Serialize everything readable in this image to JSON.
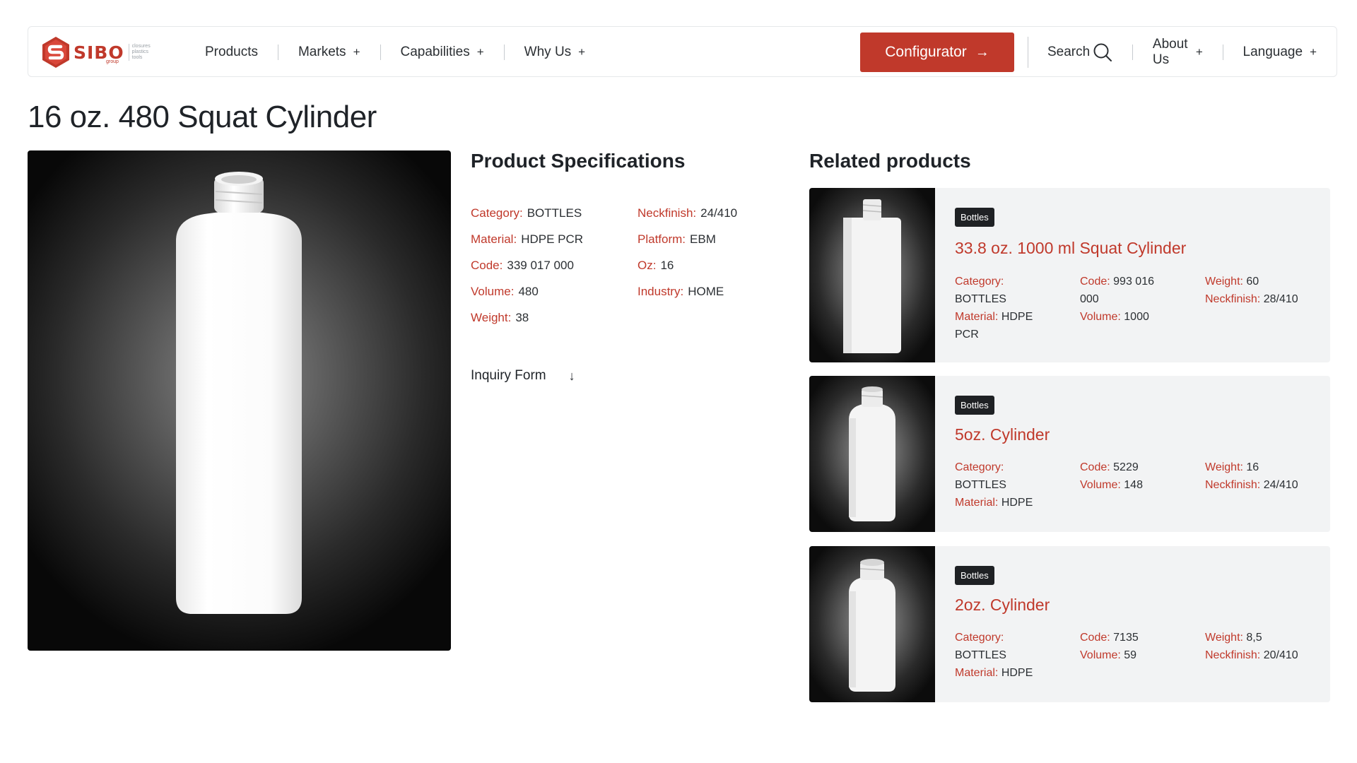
{
  "brand": {
    "logo_text": "SIBO",
    "logo_sub": [
      "closures",
      "plastics",
      "tools"
    ],
    "logo_group": "group"
  },
  "nav": {
    "products": "Products",
    "markets": "Markets",
    "capabilities": "Capabilities",
    "why_us": "Why Us",
    "plus": "+",
    "configurator": "Configurator",
    "configurator_arrow": "→",
    "search": "Search",
    "about_us": "About Us",
    "language": "Language"
  },
  "product": {
    "title": "16 oz. 480 Squat Cylinder",
    "specs_title": "Product Specifications",
    "specs": [
      {
        "label": "Category:",
        "value": "BOTTLES"
      },
      {
        "label": "Material:",
        "value": "HDPE PCR"
      },
      {
        "label": "Code:",
        "value": "339 017 000"
      },
      {
        "label": "Volume:",
        "value": "480"
      },
      {
        "label": "Weight:",
        "value": "38"
      },
      {
        "label": "Neckfinish:",
        "value": "24/410"
      },
      {
        "label": "Platform:",
        "value": "EBM"
      },
      {
        "label": "Oz:",
        "value": "16"
      },
      {
        "label": "Industry:",
        "value": "HOME"
      }
    ],
    "inquiry_label": "Inquiry Form",
    "inquiry_arrow": "↓"
  },
  "related": {
    "title": "Related products",
    "items": [
      {
        "badge": "Bottles",
        "name": "33.8 oz. 1000 ml Squat Cylinder",
        "category_label": "Category:",
        "category": "BOTTLES",
        "material_label": "Material:",
        "material": "HDPE",
        "material_extra": "PCR",
        "code_label": "Code:",
        "code": "993 016",
        "code_extra": "000",
        "volume_label": "Volume:",
        "volume": "1000",
        "weight_label": "Weight:",
        "weight": "60",
        "neck_label": "Neckfinish:",
        "neck": "28/410"
      },
      {
        "badge": "Bottles",
        "name": "5oz. Cylinder",
        "category_label": "Category:",
        "category": "BOTTLES",
        "material_label": "Material:",
        "material": "HDPE",
        "code_label": "Code:",
        "code": "5229",
        "volume_label": "Volume:",
        "volume": "148",
        "weight_label": "Weight:",
        "weight": "16",
        "neck_label": "Neckfinish:",
        "neck": "24/410"
      },
      {
        "badge": "Bottles",
        "name": "2oz. Cylinder",
        "category_label": "Category:",
        "category": "BOTTLES",
        "material_label": "Material:",
        "material": "HDPE",
        "code_label": "Code:",
        "code": "7135",
        "volume_label": "Volume:",
        "volume": "59",
        "weight_label": "Weight:",
        "weight": "8,5",
        "neck_label": "Neckfinish:",
        "neck": "20/410"
      }
    ]
  },
  "colors": {
    "accent": "#c0392b",
    "badge_bg": "#1f2124",
    "card_bg": "#f2f3f4"
  }
}
